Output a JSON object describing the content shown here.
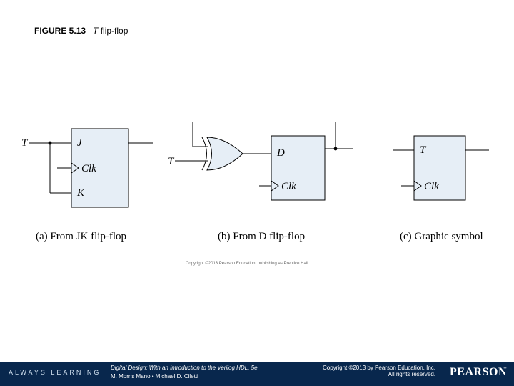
{
  "figure": {
    "number": "FIGURE 5.13",
    "title_prefix": "T",
    "title_rest": " flip-flop"
  },
  "diagram": {
    "a": {
      "input": "T",
      "j": "J",
      "k": "K",
      "clk": "Clk",
      "caption": "(a) From JK flip-flop"
    },
    "b": {
      "input": "T",
      "d": "D",
      "clk": "Clk",
      "caption": "(b) From D flip-flop"
    },
    "c": {
      "input": "T",
      "clk": "Clk",
      "caption": "(c) Graphic symbol"
    },
    "micro_copyright": "Copyright ©2013 Pearson Education, publishing as Prentice Hall"
  },
  "footer": {
    "always": "ALWAYS LEARNING",
    "book": "Digital Design: With an Introduction to the Verilog HDL, 5e",
    "authors": "M. Morris Mano • Michael D. Ciletti",
    "copyright_line1": "Copyright ©2013 by Pearson Education, Inc.",
    "copyright_line2": "All rights reserved.",
    "brand": "PEARSON"
  }
}
